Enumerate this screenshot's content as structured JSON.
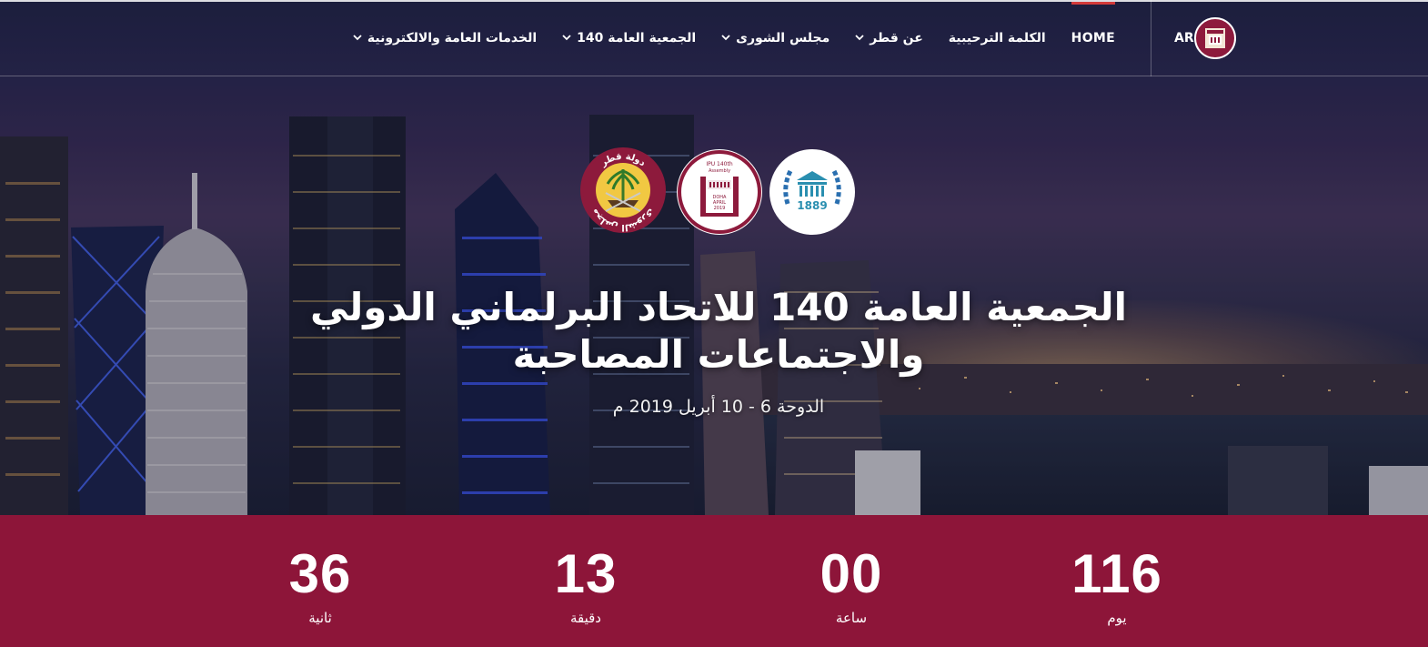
{
  "nav": {
    "lang": "AR",
    "items": [
      {
        "label": "HOME",
        "has_dropdown": false,
        "active": true
      },
      {
        "label": "الكلمة الترحيبية",
        "has_dropdown": false,
        "active": false
      },
      {
        "label": "عن قطر",
        "has_dropdown": true,
        "active": false
      },
      {
        "label": "مجلس الشورى",
        "has_dropdown": true,
        "active": false
      },
      {
        "label": "الجمعية العامة 140",
        "has_dropdown": true,
        "active": false
      },
      {
        "label": "الخدمات العامة والالكترونية",
        "has_dropdown": true,
        "active": false
      }
    ],
    "chevron_icon": "chevron-down-icon"
  },
  "emblems": {
    "qatar": {
      "top_text": "دولة قطر",
      "bottom_text": "مجلس الشورى"
    },
    "ipu140": {
      "top_text": "IPU 140th",
      "sub_text": "Assembly",
      "city": "DOHA",
      "date": "APRIL",
      "year": "2019"
    },
    "ipu": {
      "year": "1889"
    }
  },
  "hero": {
    "title": "الجمعية العامة 140 للاتحاد البرلماني الدولي والاجتماعات المصاحبة",
    "subtitle": "الدوحة 6 - 10 أبريل 2019 م"
  },
  "countdown": {
    "seconds": {
      "value": "36",
      "label": "ثانية"
    },
    "minutes": {
      "value": "13",
      "label": "دقيقة"
    },
    "hours": {
      "value": "00",
      "label": "ساعة"
    },
    "days": {
      "value": "116",
      "label": "يوم"
    }
  },
  "colors": {
    "brand_maroon": "#8d1539",
    "nav_active": "#d43a3a",
    "ipu_teal": "#2a8fb0"
  }
}
